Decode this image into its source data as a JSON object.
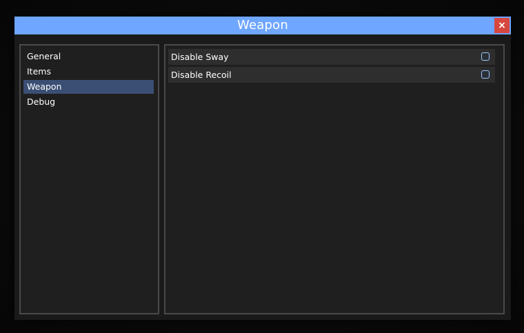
{
  "window": {
    "title": "Weapon",
    "close_label": "×"
  },
  "sidebar": {
    "items": [
      {
        "label": "General"
      },
      {
        "label": "Items"
      },
      {
        "label": "Weapon",
        "active": true
      },
      {
        "label": "Debug"
      }
    ]
  },
  "settings": {
    "rows": [
      {
        "label": "Disable Sway",
        "checked": false
      },
      {
        "label": "Disable Recoil",
        "checked": false
      }
    ]
  },
  "colors": {
    "titlebar": "#6fa6ff",
    "close_button": "#d6473f",
    "active_nav": "#3a4f73",
    "checkbox_border": "#9ec9ff"
  }
}
